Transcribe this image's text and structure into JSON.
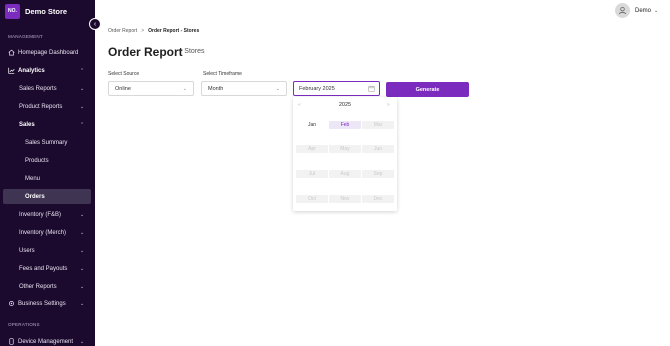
{
  "brand": {
    "logo_text": "NO.",
    "name": "Demo Store"
  },
  "sidebar": {
    "section_management": "MANAGEMENT",
    "section_operations": "OPERATIONS",
    "items": [
      {
        "label": "Homepage Dashboard",
        "icon": "home-icon"
      },
      {
        "label": "Analytics",
        "icon": "chart-icon"
      },
      {
        "label": "Sales Reports"
      },
      {
        "label": "Product Reports"
      },
      {
        "label": "Sales"
      },
      {
        "label": "Sales Summary"
      },
      {
        "label": "Products"
      },
      {
        "label": "Menu"
      },
      {
        "label": "Orders"
      },
      {
        "label": "Inventory (F&B)"
      },
      {
        "label": "Inventory (Merch)"
      },
      {
        "label": "Users"
      },
      {
        "label": "Fees and Payouts"
      },
      {
        "label": "Other Reports"
      },
      {
        "label": "Business Settings",
        "icon": "gear-icon"
      },
      {
        "label": "Device Management",
        "icon": "device-icon"
      }
    ]
  },
  "user": {
    "name": "Demo"
  },
  "breadcrumb": {
    "parent": "Order Report",
    "separator": ">",
    "current": "Order Report - Stores"
  },
  "page": {
    "title": "Order Report",
    "subtitle": "- Stores"
  },
  "form": {
    "source_label": "Select Source",
    "source_value": "Online",
    "timeframe_label": "Select Timeframe",
    "timeframe_value": "Month",
    "date_value": "February 2025",
    "generate_label": "Generate"
  },
  "picker": {
    "year": "2025",
    "prev": "«",
    "next": "»",
    "months": [
      {
        "label": "Jan",
        "state": "enabled"
      },
      {
        "label": "Feb",
        "state": "selected"
      },
      {
        "label": "Mar",
        "state": "disabled"
      },
      {
        "label": "Apr",
        "state": "disabled"
      },
      {
        "label": "May",
        "state": "disabled"
      },
      {
        "label": "Jun",
        "state": "disabled"
      },
      {
        "label": "Jul",
        "state": "disabled"
      },
      {
        "label": "Aug",
        "state": "disabled"
      },
      {
        "label": "Sep",
        "state": "disabled"
      },
      {
        "label": "Oct",
        "state": "disabled"
      },
      {
        "label": "Nov",
        "state": "disabled"
      },
      {
        "label": "Dec",
        "state": "disabled"
      }
    ]
  },
  "colors": {
    "sidebar_bg": "#1b0a2e",
    "accent": "#7b2cbf",
    "active_item_bg": "#3f3553"
  }
}
